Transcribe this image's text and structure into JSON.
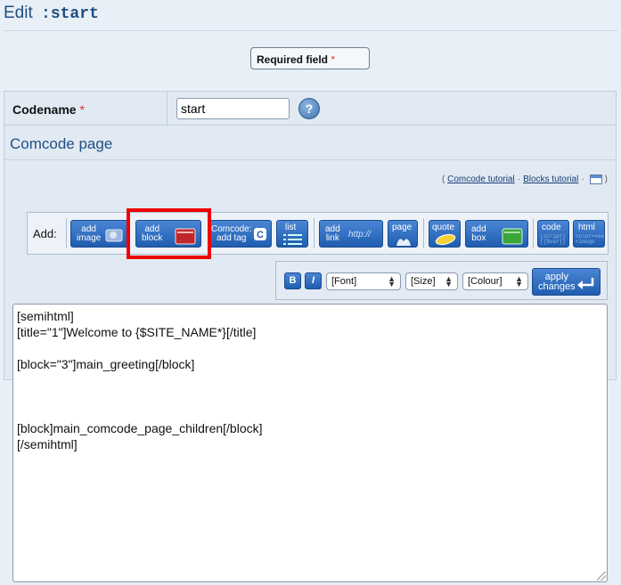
{
  "header": {
    "title": "Edit",
    "code": ":start"
  },
  "required": {
    "label": "Required field",
    "star": "*"
  },
  "codename": {
    "label": "Codename",
    "star": "*",
    "value": "start",
    "help": "?"
  },
  "section": {
    "title": "Comcode page"
  },
  "tutorials": {
    "open": "(",
    "comcode": "Comcode tutorial",
    "dot1": "·",
    "blocks": "Blocks tutorial",
    "dot2": "·",
    "close": ")"
  },
  "toolbar": {
    "add_label": "Add:",
    "buttons": [
      {
        "line1": "add",
        "line2": "image",
        "icon": "image-icon"
      },
      {
        "line1": "add",
        "line2": "block",
        "icon": "block-icon"
      },
      {
        "line1": "Comcode:",
        "line2": "add tag",
        "icon": "comcode-icon"
      },
      {
        "line1": "list",
        "line2": "",
        "icon": "list-icon"
      },
      {
        "line1": "add",
        "line2": "link",
        "icon": "link-icon",
        "extra": "http://"
      },
      {
        "line1": "page",
        "line2": "",
        "icon": "page-icon"
      },
      {
        "line1": "quote",
        "line2": "",
        "icon": "quote-icon"
      },
      {
        "line1": "add",
        "line2": "box",
        "icon": "box-icon"
      },
      {
        "line1": "code",
        "line2": "",
        "icon": "code-icon",
        "extra": "{script} {{$var}}"
      },
      {
        "line1": "html",
        "line2": "",
        "icon": "html-icon",
        "extra": "color=#eee <image"
      }
    ]
  },
  "format": {
    "bold": "B",
    "italic": "I",
    "font": "[Font]",
    "size": "[Size]",
    "colour": "[Colour]",
    "apply_line1": "apply",
    "apply_line2": "changes"
  },
  "editor": {
    "content": "[semihtml]\n[title=\"1\"]Welcome to {$SITE_NAME*}[/title]\n\n[block=\"3\"]main_greeting[/block]\n\n\n\n[block]main_comcode_page_children[/block]\n[/semihtml]"
  },
  "colors": {
    "accent": "#1f4f83",
    "button": "#2e6dc0",
    "highlight": "#ee0000"
  }
}
